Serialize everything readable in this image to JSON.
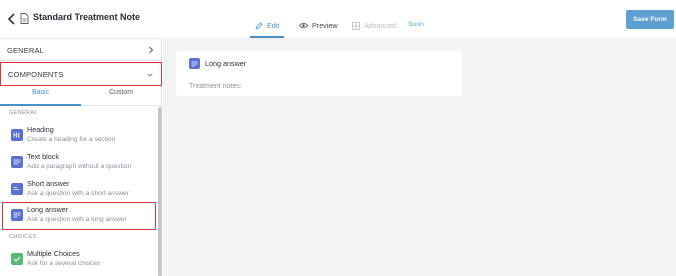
{
  "header": {
    "title": "Standard Treatment Note",
    "tabs": [
      {
        "label": "Edit",
        "icon": "pencil-icon"
      },
      {
        "label": "Preview",
        "icon": "eye-icon"
      },
      {
        "label": "Advanced",
        "icon": "grid-icon"
      }
    ],
    "advanced_badge": "Soon",
    "save_label": "Save Form"
  },
  "sidebar": {
    "general_label": "GENERAL",
    "components_label": "COMPONENTS",
    "subtabs": [
      "Basic",
      "Custom"
    ],
    "groups": {
      "general": "GENERAL",
      "choices": "CHOICES"
    },
    "items": [
      {
        "title": "Heading",
        "desc": "Create a heading for a section",
        "icon": "heading-icon"
      },
      {
        "title": "Text block",
        "desc": "Add a paragraph without a question",
        "icon": "text-block-icon"
      },
      {
        "title": "Short answer",
        "desc": "Ask a question with a short answer",
        "icon": "short-answer-icon"
      },
      {
        "title": "Long answer",
        "desc": "Ask a question with a long answer",
        "icon": "long-answer-icon"
      },
      {
        "title": "Multiple Choices",
        "desc": "Ask for a several choices",
        "icon": "checkbox-icon"
      }
    ]
  },
  "canvas": {
    "card_title": "Long answer",
    "card_notes": "Treatment notes:"
  },
  "colors": {
    "accent": "#4a90c8",
    "save_button": "#5ea0d4",
    "highlight": "#d23838",
    "component_icon": "#5b6fd1",
    "choice_icon": "#59b77a",
    "canvas_bg": "#f2f3f5"
  }
}
